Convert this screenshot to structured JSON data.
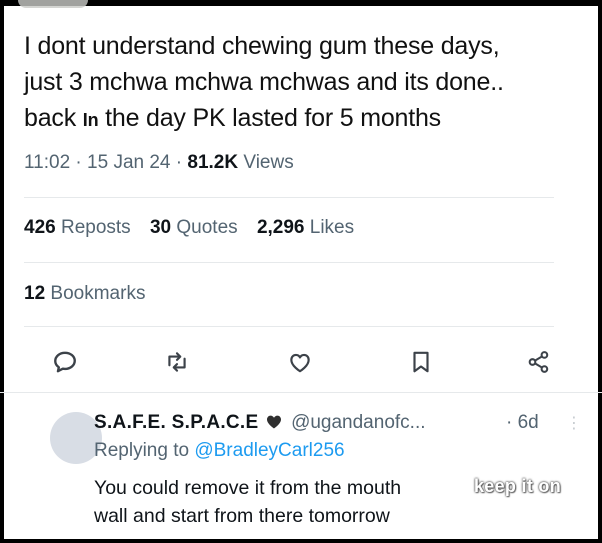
{
  "tweet": {
    "lines": [
      "I dont understand chewing gum these days,",
      "just 3 mchwa mchwa mchwas and its done..",
      "back",
      "In",
      "the day PK lasted for 5 months"
    ],
    "time": "11:02",
    "date": "15 Jan 24",
    "views_count": "81.2K",
    "views_label": "Views",
    "sep": "·"
  },
  "stats": {
    "reposts_count": "426",
    "reposts_label": "Reposts",
    "quotes_count": "30",
    "quotes_label": "Quotes",
    "likes_count": "2,296",
    "likes_label": "Likes",
    "bookmarks_count": "12",
    "bookmarks_label": "Bookmarks"
  },
  "actions": [
    {
      "name": "reply-icon"
    },
    {
      "name": "repost-icon"
    },
    {
      "name": "like-icon"
    },
    {
      "name": "bookmark-icon"
    },
    {
      "name": "share-icon"
    }
  ],
  "reply": {
    "name": "S.A.F.E. S.P.A.C.E",
    "handle": "@ugandanofc...",
    "time": "· 6d",
    "menu": "⋮",
    "replying_prefix": "Replying to",
    "replying_to": "@BradleyCarl256",
    "text_line1": "You could remove it from the mouth",
    "text_line2": "wall and start from there tomorrow",
    "watermark": "keep it on"
  },
  "colors": {
    "text": "#0f1419",
    "muted": "#536471",
    "link": "#1d9bf0",
    "avatar": "#d8dde5",
    "heart": "#3a3a3a"
  }
}
